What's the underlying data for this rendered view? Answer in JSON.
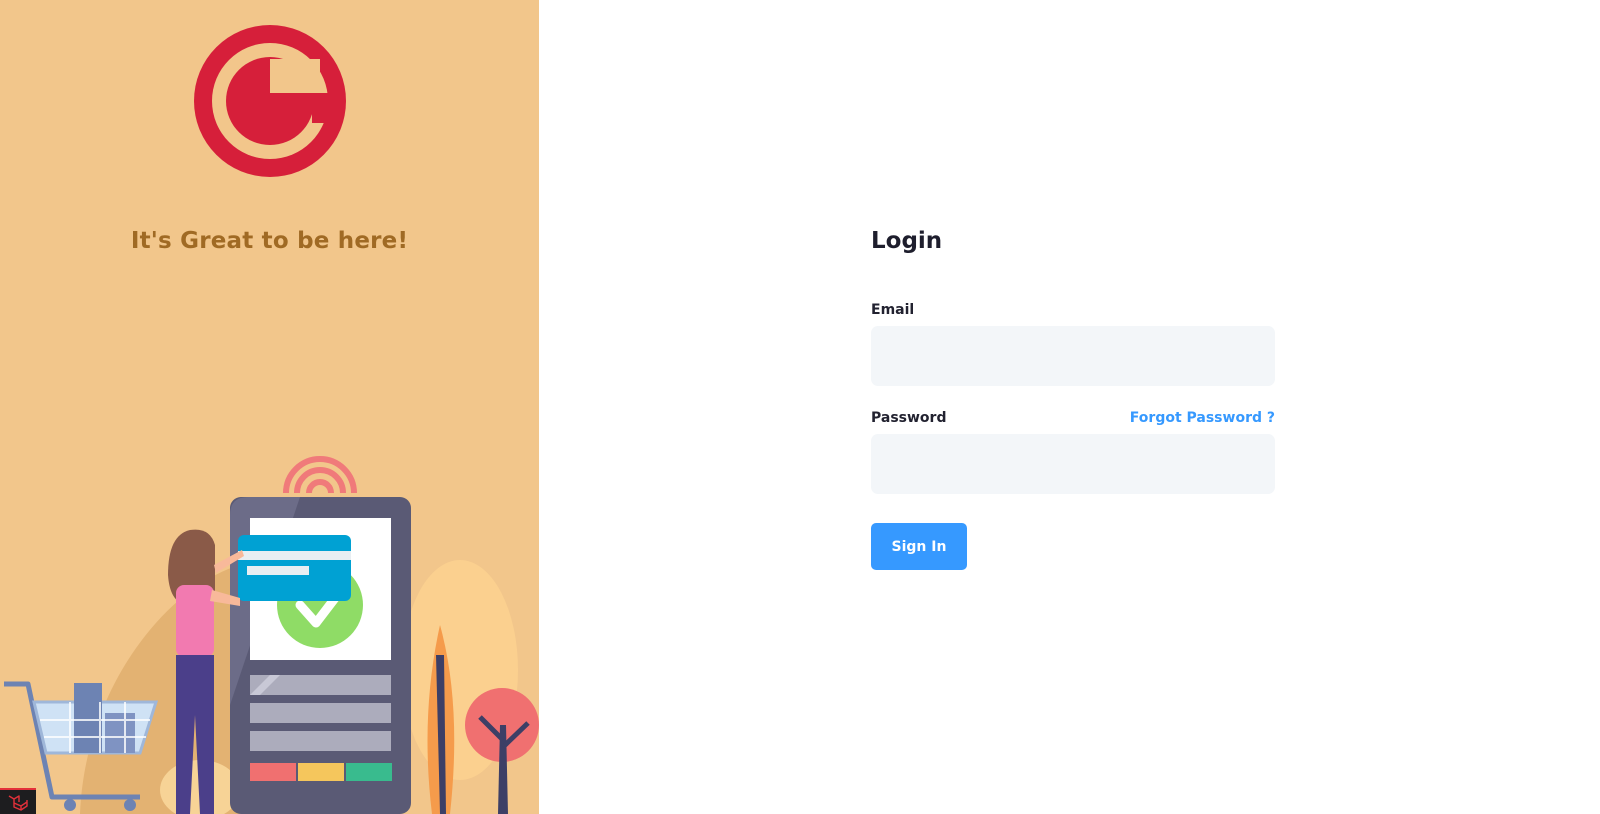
{
  "aside": {
    "tagline": "It's Great to be here!"
  },
  "login": {
    "title": "Login",
    "email_label": "Email",
    "email_value": "",
    "password_label": "Password",
    "password_value": "",
    "forgot_label": "Forgot Password ?",
    "submit_label": "Sign In"
  },
  "icons": {
    "logo": "g-logo-icon",
    "badge": "laravel-icon"
  },
  "colors": {
    "aside_bg": "#f2c68b",
    "brand_red": "#d61f3a",
    "tagline": "#a06a24",
    "primary": "#3699ff",
    "input_bg": "#f3f6f9"
  }
}
